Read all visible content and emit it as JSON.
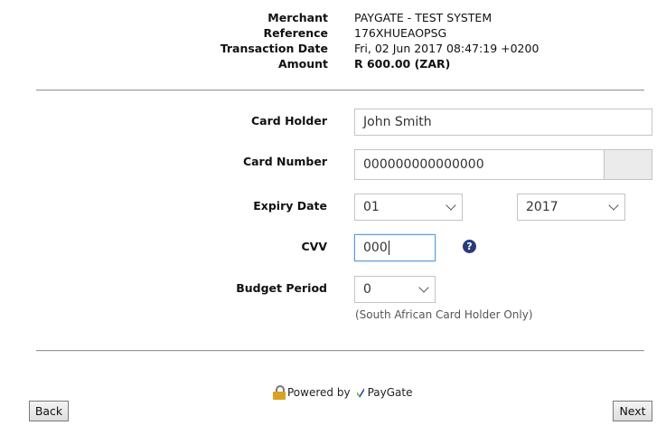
{
  "summary": {
    "merchant_label": "Merchant",
    "merchant_value": "PAYGATE - TEST SYSTEM",
    "reference_label": "Reference",
    "reference_value": "176XHUEAOPSG",
    "date_label": "Transaction Date",
    "date_value": "Fri, 02 Jun 2017 08:47:19 +0200",
    "amount_label": "Amount",
    "amount_value": "R 600.00 (ZAR)"
  },
  "form": {
    "card_holder_label": "Card Holder",
    "card_holder_value": "John Smith",
    "card_number_label": "Card Number",
    "card_number_value": "000000000000000",
    "expiry_label": "Expiry Date",
    "expiry_month": "01",
    "expiry_year": "2017",
    "cvv_label": "CVV",
    "cvv_value": "000",
    "cvv_help": "?",
    "budget_label": "Budget Period",
    "budget_value": "0",
    "budget_note": "(South African Card Holder Only)"
  },
  "footer": {
    "powered_by": "Powered by",
    "brand": "PayGate",
    "back_label": "Back",
    "next_label": "Next"
  },
  "icons": {
    "lock": "lock-icon",
    "paygate_logo": "paygate-logo-icon",
    "help": "question-circle-icon",
    "chevron": "chevron-down-icon"
  },
  "colors": {
    "help_icon": "#2b3a7a",
    "focus_border": "#5b9bd5",
    "logo_green": "#7ab648",
    "logo_blue": "#2e4a9e"
  }
}
